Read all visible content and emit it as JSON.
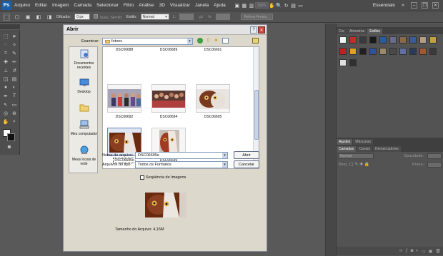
{
  "app": {
    "logo": "Ps",
    "workspace": "Essenciais"
  },
  "menu": [
    "Arquivo",
    "Editar",
    "Imagem",
    "Camada",
    "Selecionar",
    "Filtro",
    "Análise",
    "3D",
    "Visualizar",
    "Janela",
    "Ajuda"
  ],
  "menubar": {
    "zoom_label": "100%"
  },
  "options": {
    "diffusion_label": "Difusão:",
    "diffusion_value": "0 px",
    "antialias_label": "Suav. Serrilh.",
    "style_label": "Estilo:",
    "style_value": "Normal",
    "width_label": "L:",
    "height_label": "A:",
    "refine_label": "Refinar Aresta..."
  },
  "dialog": {
    "title": "Abrir",
    "lookin_label": "Examinar:",
    "lookin_value": "fotoos",
    "places": [
      {
        "label": "Documentos recentes",
        "icon": "recent-documents-icon"
      },
      {
        "label": "Desktop",
        "icon": "desktop-icon"
      },
      {
        "label": "Meus documentos",
        "icon": "my-documents-icon"
      },
      {
        "label": "Meu computador",
        "icon": "my-computer-icon"
      },
      {
        "label": "Meus locais de rede",
        "icon": "network-places-icon"
      }
    ],
    "files_top_partial": [
      "DSC06688",
      "DSC06689",
      "DSC06691"
    ],
    "files": [
      {
        "name": "DSC06692",
        "selected": false
      },
      {
        "name": "DSC06694",
        "selected": false
      },
      {
        "name": "DSC06695",
        "selected": false
      },
      {
        "name": "DSC06695e",
        "selected": true
      },
      {
        "name": "DSC06696",
        "selected": false
      }
    ],
    "filename_label": "Nome do arquivo:",
    "filename_value": "DSC06695e",
    "filetype_label": "Arquivos do tipo:",
    "filetype_value": "Todos os Formatos",
    "open_button": "Abrir",
    "cancel_button": "Cancelar",
    "sequence_label": "Seqüência de Imagens",
    "filesize_label": "Tamanho do Arquivo: 4,15M"
  },
  "panels": {
    "top_tabs": [
      "Cor",
      "Amostras",
      "Estilos"
    ],
    "mid_tabs": [
      "Ajustes",
      "Máscaras"
    ],
    "layer_tabs": [
      "Camadas",
      "Canais",
      "Demarcadores"
    ],
    "blend_mode": "Normal",
    "opacity_label": "Opacidade:",
    "lock_label": "Bloq.:",
    "fill_label": "Preen.:"
  },
  "colors": {
    "accent": "#1b5ea8",
    "dialog_bg": "#dcd8cc",
    "close_red": "#c8463a"
  }
}
